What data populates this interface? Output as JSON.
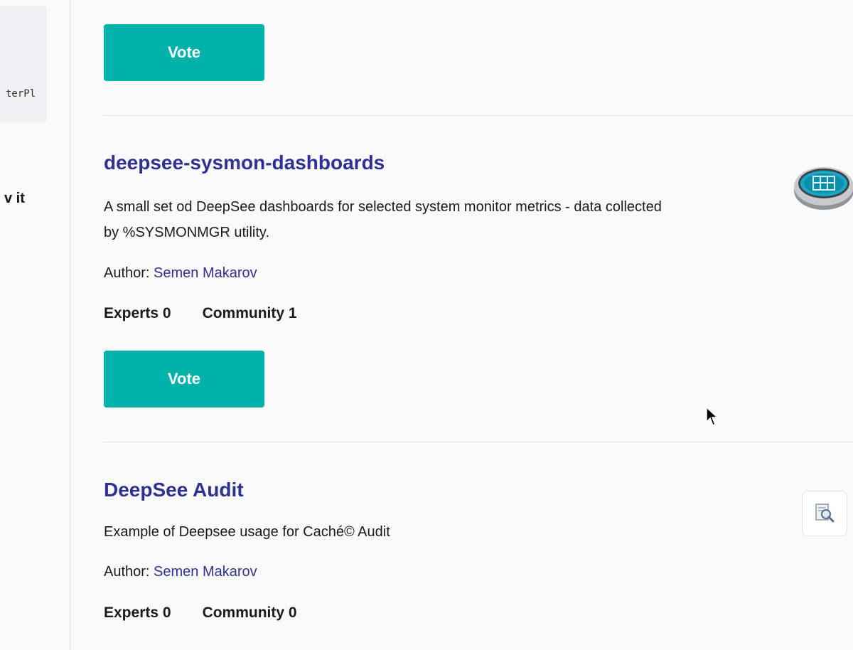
{
  "left_panel": {
    "code_snippet": "terPl",
    "fragment_text": "v it"
  },
  "items": [
    {
      "vote_label": "Vote"
    },
    {
      "title": "deepsee-sysmon-dashboards",
      "description": "A small set od DeepSee dashboards for selected system monitor metrics - data collected by %SYSMONMGR utility.",
      "author_prefix": "Author: ",
      "author_name": "Semen Makarov",
      "experts_label": "Experts 0",
      "community_label": "Community 1",
      "vote_label": "Vote",
      "logo_icon": "database-dashboard-icon"
    },
    {
      "title": "DeepSee Audit",
      "description": "Example of Deepsee usage for Caché© Audit",
      "author_prefix": "Author: ",
      "author_name": "Semen Makarov",
      "experts_label": "Experts 0",
      "community_label": "Community 0",
      "logo_icon": "audit-magnifier-icon"
    }
  ],
  "colors": {
    "accent": "#00b2a9",
    "link": "#2e3192",
    "background": "#fafafa",
    "divider": "#e0e0e0"
  }
}
